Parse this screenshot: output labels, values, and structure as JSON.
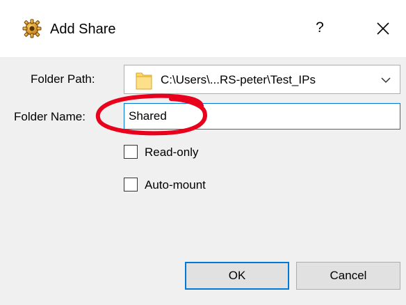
{
  "window": {
    "title": "Add Share",
    "app_icon": "gear-cog-icon",
    "help_label": "?",
    "close_icon": "close-icon"
  },
  "form": {
    "folder_path": {
      "label": "Folder Path:",
      "value": "C:\\Users\\...RS-peter\\Test_IPs",
      "icon": "folder-icon"
    },
    "folder_name": {
      "label": "Folder Name:",
      "value": "Shared"
    },
    "options": [
      {
        "label": "Read-only",
        "checked": false
      },
      {
        "label": "Auto-mount",
        "checked": false
      }
    ]
  },
  "buttons": {
    "ok_label": "OK",
    "cancel_label": "Cancel"
  },
  "colors": {
    "accent": "#0078d7",
    "annotation": "#e8001c",
    "dialog_bg": "#f0f0f0"
  }
}
